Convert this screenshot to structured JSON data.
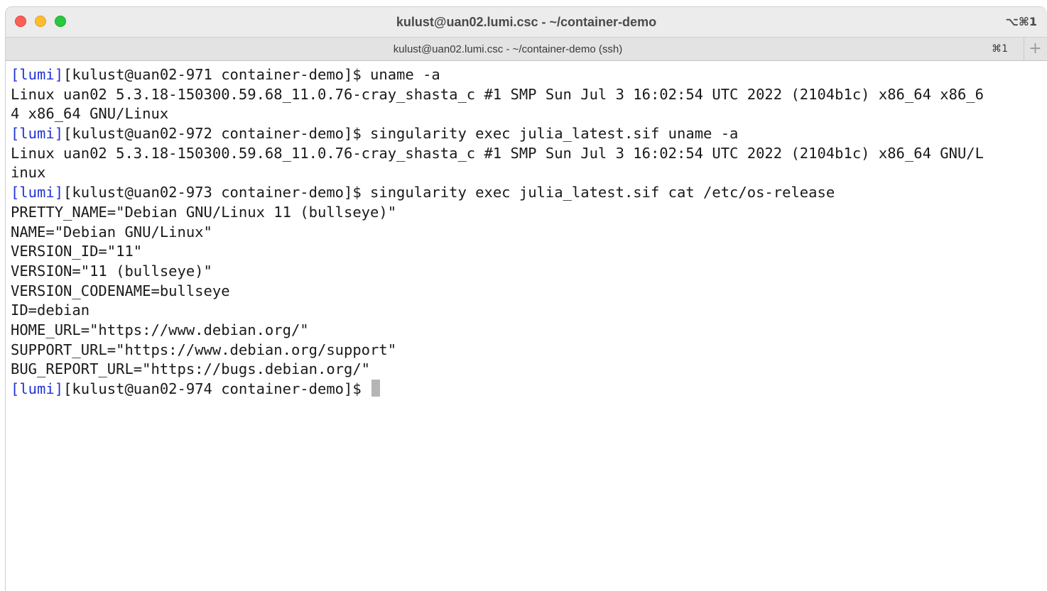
{
  "window": {
    "title": "kulust@uan02.lumi.csc - ~/container-demo",
    "shortcut": "⌥⌘1"
  },
  "tabs": [
    {
      "label": "kulust@uan02.lumi.csc - ~/container-demo (ssh)",
      "shortcut": "⌘1"
    }
  ],
  "new_tab_icon": "+",
  "colors": {
    "prompt_tag": "#2133d6",
    "text": "#1a1a1a",
    "cursor": "#b5b5b5"
  },
  "terminal": {
    "lines": [
      {
        "tag": "[lumi]",
        "text": "[kulust@uan02-971 container-demo]$ uname -a"
      },
      {
        "tag": "",
        "text": "Linux uan02 5.3.18-150300.59.68_11.0.76-cray_shasta_c #1 SMP Sun Jul 3 16:02:54 UTC 2022 (2104b1c) x86_64 x86_6"
      },
      {
        "tag": "",
        "text": "4 x86_64 GNU/Linux"
      },
      {
        "tag": "[lumi]",
        "text": "[kulust@uan02-972 container-demo]$ singularity exec julia_latest.sif uname -a"
      },
      {
        "tag": "",
        "text": "Linux uan02 5.3.18-150300.59.68_11.0.76-cray_shasta_c #1 SMP Sun Jul 3 16:02:54 UTC 2022 (2104b1c) x86_64 GNU/L"
      },
      {
        "tag": "",
        "text": "inux"
      },
      {
        "tag": "[lumi]",
        "text": "[kulust@uan02-973 container-demo]$ singularity exec julia_latest.sif cat /etc/os-release"
      },
      {
        "tag": "",
        "text": "PRETTY_NAME=\"Debian GNU/Linux 11 (bullseye)\""
      },
      {
        "tag": "",
        "text": "NAME=\"Debian GNU/Linux\""
      },
      {
        "tag": "",
        "text": "VERSION_ID=\"11\""
      },
      {
        "tag": "",
        "text": "VERSION=\"11 (bullseye)\""
      },
      {
        "tag": "",
        "text": "VERSION_CODENAME=bullseye"
      },
      {
        "tag": "",
        "text": "ID=debian"
      },
      {
        "tag": "",
        "text": "HOME_URL=\"https://www.debian.org/\""
      },
      {
        "tag": "",
        "text": "SUPPORT_URL=\"https://www.debian.org/support\""
      },
      {
        "tag": "",
        "text": "BUG_REPORT_URL=\"https://bugs.debian.org/\""
      }
    ],
    "current_prompt": {
      "tag": "[lumi]",
      "text": "[kulust@uan02-974 container-demo]$ "
    }
  }
}
